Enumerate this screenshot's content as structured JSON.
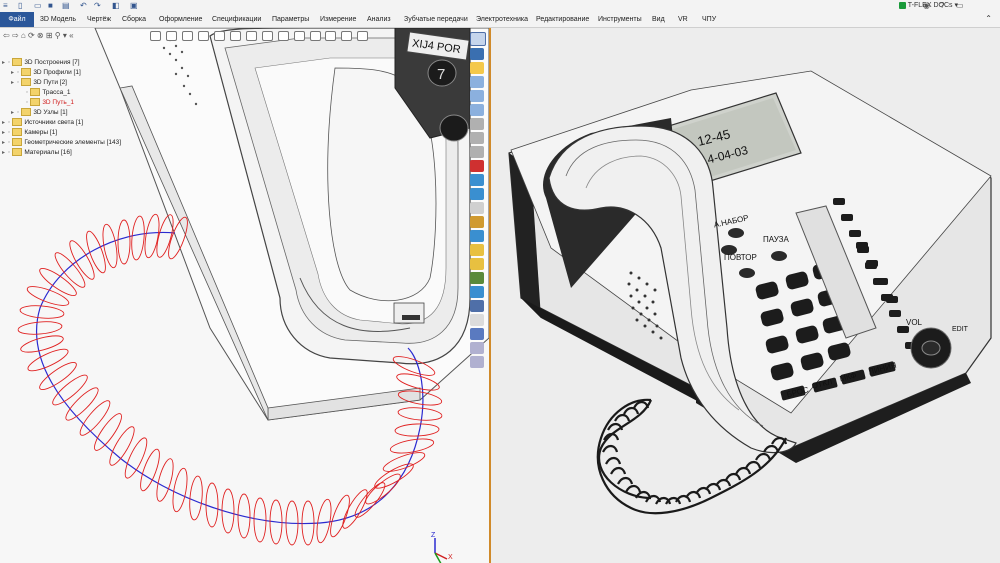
{
  "quick_access": {
    "icons": [
      "menu-icon",
      "new-document-icon",
      "open-folder-icon",
      "save-icon",
      "print-icon",
      "undo-icon",
      "redo-icon",
      "render-icon",
      "screen-icon"
    ]
  },
  "app": {
    "docs_label": "T-FLEX DOCs",
    "right_icons": [
      "eye-icon",
      "help-icon",
      "minimize-icon"
    ]
  },
  "menu": {
    "file": "Файл",
    "items": [
      "3D Модель",
      "Чертёж",
      "Сборка",
      "Оформление",
      "Спецификации",
      "Параметры",
      "Измерение",
      "Анализ",
      "Зубчатые передачи",
      "Электротехника",
      "Редактирование",
      "Инструменты",
      "Вид",
      "VR",
      "ЧПУ"
    ]
  },
  "tree": {
    "items": [
      {
        "label": "3D Построения [7]",
        "level": 0,
        "color": "#222"
      },
      {
        "label": "3D Профили [1]",
        "level": 1,
        "color": "#222"
      },
      {
        "label": "3D Пути [2]",
        "level": 1,
        "color": "#222"
      },
      {
        "label": "Трасса_1",
        "level": 2,
        "color": "#222"
      },
      {
        "label": "3D Путь_1",
        "level": 2,
        "color": "#d02020"
      },
      {
        "label": "3D Узлы [1]",
        "level": 1,
        "color": "#222"
      },
      {
        "label": "Источники света [1]",
        "level": 0,
        "color": "#222"
      },
      {
        "label": "Камеры [1]",
        "level": 0,
        "color": "#222"
      },
      {
        "label": "Геометрические элементы [143]",
        "level": 0,
        "color": "#222"
      },
      {
        "label": "Материалы [16]",
        "level": 0,
        "color": "#222"
      }
    ]
  },
  "left_model": {
    "display_label": "XIJ4 POR",
    "triad": {
      "x": "X",
      "y": "Y",
      "z": "Z"
    }
  },
  "phone": {
    "lcd_line1": "12-45",
    "lcd_line2": "2014-04-03",
    "btn_redial_label": "А.НАБОР",
    "btn_repeat_label": "ПОВТОР",
    "btn_pause_label": "ПАУЗА",
    "btn_bottom_labels": [
      "БРОС",
      "ОТКЛ",
      "МКФ",
      "ЛИНИЯ"
    ],
    "vol_label": "VOL",
    "edit_label": "EDIT"
  },
  "colors": {
    "accent": "#2b579a",
    "coil_red": "#e02020",
    "path_blue": "#2020c0",
    "frame": "#d08a2a"
  }
}
